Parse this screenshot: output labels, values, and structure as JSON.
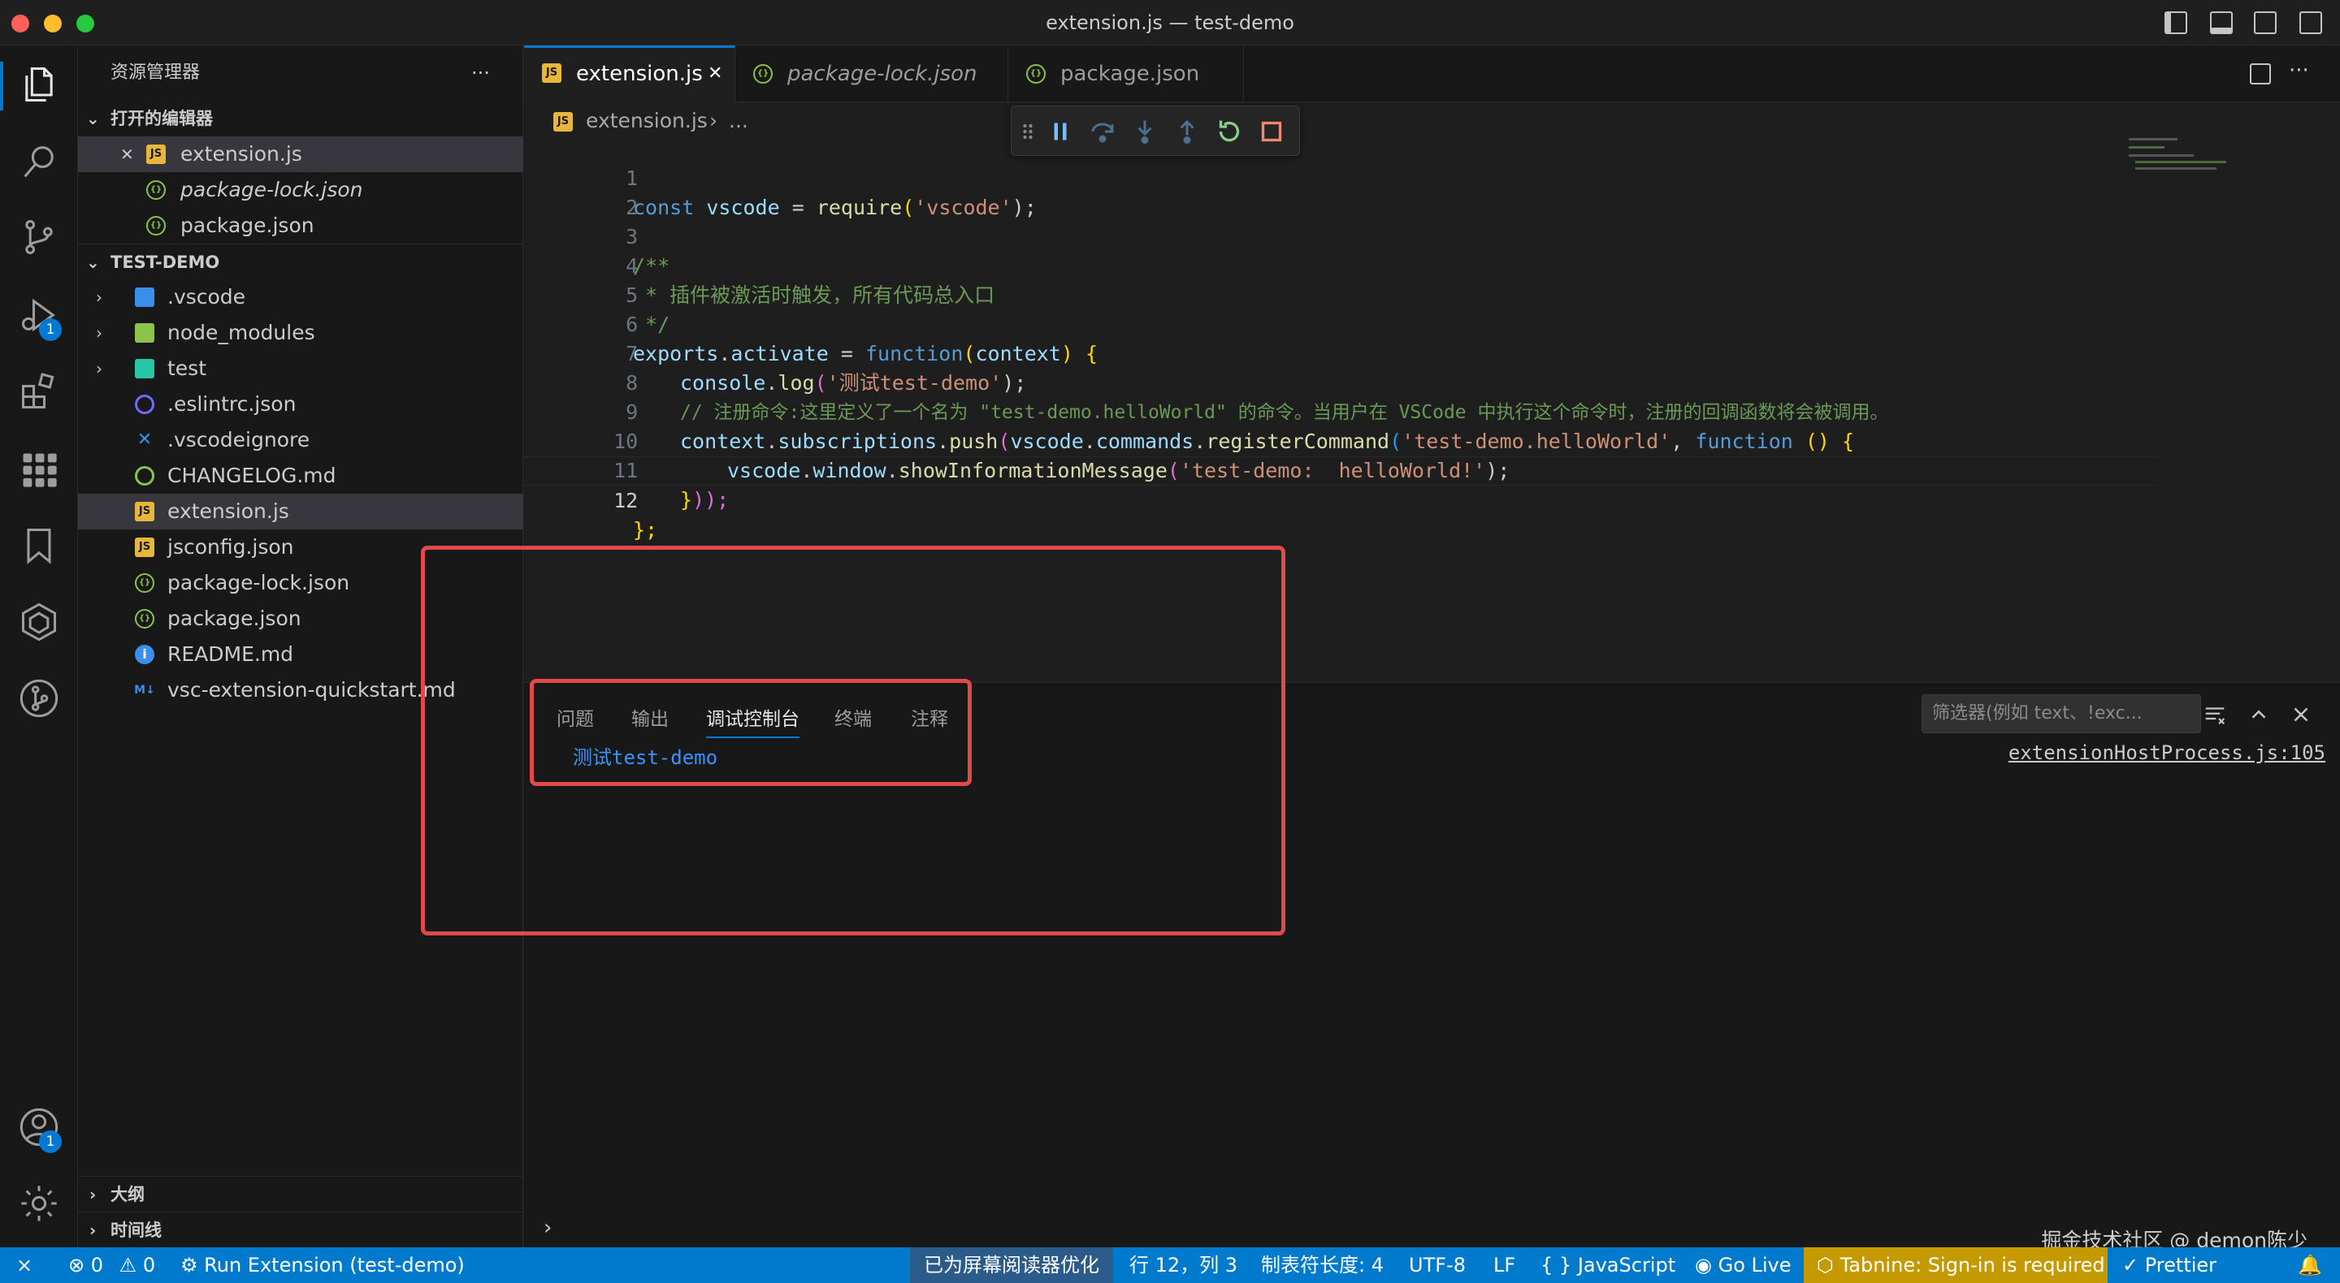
{
  "window": {
    "title": "extension.js — test-demo",
    "traffic_colors": [
      "#ff5f57",
      "#febc2e",
      "#28c840"
    ]
  },
  "activity": {
    "run_badge": "1",
    "accounts_badge": "1"
  },
  "explorer": {
    "header": "资源管理器",
    "more": "···",
    "open_editors_title": "打开的编辑器",
    "open_editors": [
      {
        "name": "extension.js",
        "icon": "js-file-icon"
      },
      {
        "name": "package-lock.json",
        "icon": "json-file-icon"
      },
      {
        "name": "package.json",
        "icon": "json-file-icon"
      }
    ],
    "close_glyph": "✕",
    "project_title": "TEST-DEMO",
    "files": [
      {
        "name": ".vscode",
        "type": "folder"
      },
      {
        "name": "node_modules",
        "type": "folder"
      },
      {
        "name": "test",
        "type": "folder"
      },
      {
        "name": ".eslintrc.json",
        "type": "eslint"
      },
      {
        "name": ".vscodeignore",
        "type": "vscode"
      },
      {
        "name": "CHANGELOG.md",
        "type": "changelog"
      },
      {
        "name": "extension.js",
        "type": "js"
      },
      {
        "name": "jsconfig.json",
        "type": "jsconfig"
      },
      {
        "name": "package-lock.json",
        "type": "json"
      },
      {
        "name": "package.json",
        "type": "json"
      },
      {
        "name": "README.md",
        "type": "info"
      },
      {
        "name": "vsc-extension-quickstart.md",
        "type": "md"
      }
    ],
    "outline_title": "大纲",
    "timeline_title": "时间线"
  },
  "tabs": [
    {
      "label": "extension.js",
      "active": true
    },
    {
      "label": "package-lock.json",
      "active": false
    },
    {
      "label": "package.json",
      "active": false
    }
  ],
  "icon_labels": {
    "js": "JS",
    "json": "{}",
    "md": "M↓",
    "info": "i"
  },
  "breadcrumb": {
    "file": "extension.js",
    "sep": "›",
    "more": "..."
  },
  "code": {
    "line_numbers": [
      "1",
      "2",
      "3",
      "4",
      "5",
      "6",
      "7",
      "8",
      "9",
      "10",
      "11",
      "12"
    ],
    "l1_a": "const",
    "l1_b": "vscode",
    "l1_c": "=",
    "l1_d": "require",
    "l1_e": "(",
    "l1_f": "'vscode'",
    "l1_g": ");",
    "l3": "/**",
    "l4": " * 插件被激活时触发，所有代码总入口",
    "l5": " */",
    "l6_a": "exports",
    "l6_b": ".",
    "l6_c": "activate",
    "l6_d": " = ",
    "l6_e": "function",
    "l6_f": "(",
    "l6_g": "context",
    "l6_h": ")",
    "l6_i": " {",
    "l7_a": "console",
    "l7_b": ".",
    "l7_c": "log",
    "l7_d": "(",
    "l7_e": "'测试test-demo'",
    "l7_f": ");",
    "l8": "// 注册命令:这里定义了一个名为 \"test-demo.helloWorld\" 的命令。当用户在 VSCode 中执行这个命令时，注册的回调函数将会被调用。",
    "l9_a": "context",
    "l9_b": ".",
    "l9_c": "subscriptions",
    "l9_d": ".",
    "l9_e": "push",
    "l9_f": "(",
    "l9_g": "vscode",
    "l9_h": ".",
    "l9_i": "commands",
    "l9_j": ".",
    "l9_k": "registerCommand",
    "l9_l": "(",
    "l9_m": "'test-demo.helloWorld'",
    "l9_n": ", ",
    "l9_o": "function",
    "l9_p": " () {",
    "l10_a": "vscode",
    "l10_b": ".",
    "l10_c": "window",
    "l10_d": ".",
    "l10_e": "showInformationMessage",
    "l10_f": "(",
    "l10_g": "'test-demo:  helloWorld!'",
    "l10_h": ");",
    "l11_a": "}",
    "l11_b": "));",
    "l12": "};"
  },
  "panel": {
    "tabs": [
      "问题",
      "输出",
      "调试控制台",
      "终端",
      "注释"
    ],
    "active_tab": "调试控制台",
    "filter_placeholder": "筛选器(例如 text、!exc...",
    "console_output": "测试test-demo",
    "console_source": "extensionHostProcess.js:105",
    "prompt": "›"
  },
  "statusbar": {
    "remote": "⨯",
    "errors": "0",
    "warnings": "0",
    "run": "Run Extension (test-demo)",
    "screen_reader": "已为屏幕阅读器优化",
    "position": "行 12，列 3",
    "tab_size": "制表符长度: 4",
    "encoding": "UTF-8",
    "eol": "LF",
    "language": "JavaScript",
    "golive": "Go Live",
    "tabnine": "Tabnine: Sign-in is required",
    "prettier": "Prettier",
    "colors": {
      "bar": "#007acc",
      "screen_reader_bg": "#2b5b8a",
      "tabnine_bg": "#c49a00"
    }
  },
  "watermark": "掘金技术社区 @ demon陈少"
}
